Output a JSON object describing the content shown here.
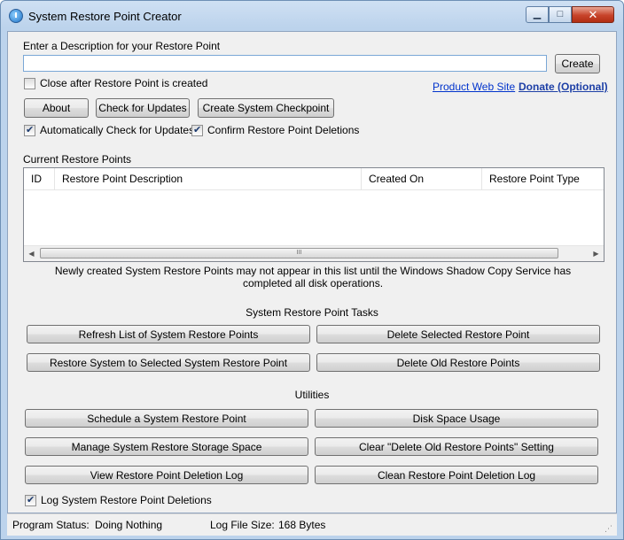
{
  "window": {
    "title": "System Restore Point Creator",
    "controls": {
      "minimize": "▁",
      "maximize": "□",
      "close": "✕"
    }
  },
  "form": {
    "description_label": "Enter a Description for your Restore Point",
    "description_value": "",
    "create_label": "Create",
    "close_after": {
      "label": "Close after Restore Point is created",
      "checked": false
    },
    "links": {
      "product_web_site": "Product Web Site",
      "donate": "Donate (Optional)"
    },
    "buttons": {
      "about": "About",
      "check_updates": "Check for Updates",
      "create_checkpoint": "Create System Checkpoint"
    },
    "auto_check": {
      "label": "Automatically Check for Updates",
      "checked": true
    },
    "confirm_deletions": {
      "label": "Confirm Restore Point Deletions",
      "checked": true
    }
  },
  "restore_points": {
    "label": "Current Restore Points",
    "columns": [
      "ID",
      "Restore Point Description",
      "Created On",
      "Restore Point Type"
    ],
    "rows": [],
    "scrollbar_grip": "III",
    "note": "Newly created System Restore Points may not appear in this list until the Windows Shadow Copy Service has completed all disk operations."
  },
  "tasks": {
    "heading": "System Restore Point Tasks",
    "refresh": "Refresh List of System Restore Points",
    "delete_selected": "Delete Selected Restore Point",
    "restore_selected": "Restore System to Selected System Restore Point",
    "delete_old": "Delete Old Restore Points"
  },
  "utilities": {
    "heading": "Utilities",
    "schedule": "Schedule a System Restore Point",
    "disk_space": "Disk Space Usage",
    "manage_storage": "Manage System Restore Storage Space",
    "clear_setting": "Clear \"Delete Old Restore Points\" Setting",
    "view_log": "View Restore Point Deletion Log",
    "clean_log": "Clean Restore Point Deletion Log"
  },
  "log_deletions": {
    "label": "Log System Restore Point Deletions",
    "checked": true
  },
  "status": {
    "program_status_label": "Program Status:",
    "program_status_value": "Doing Nothing",
    "log_size_label": "Log File Size:",
    "log_size_value": "168 Bytes"
  }
}
